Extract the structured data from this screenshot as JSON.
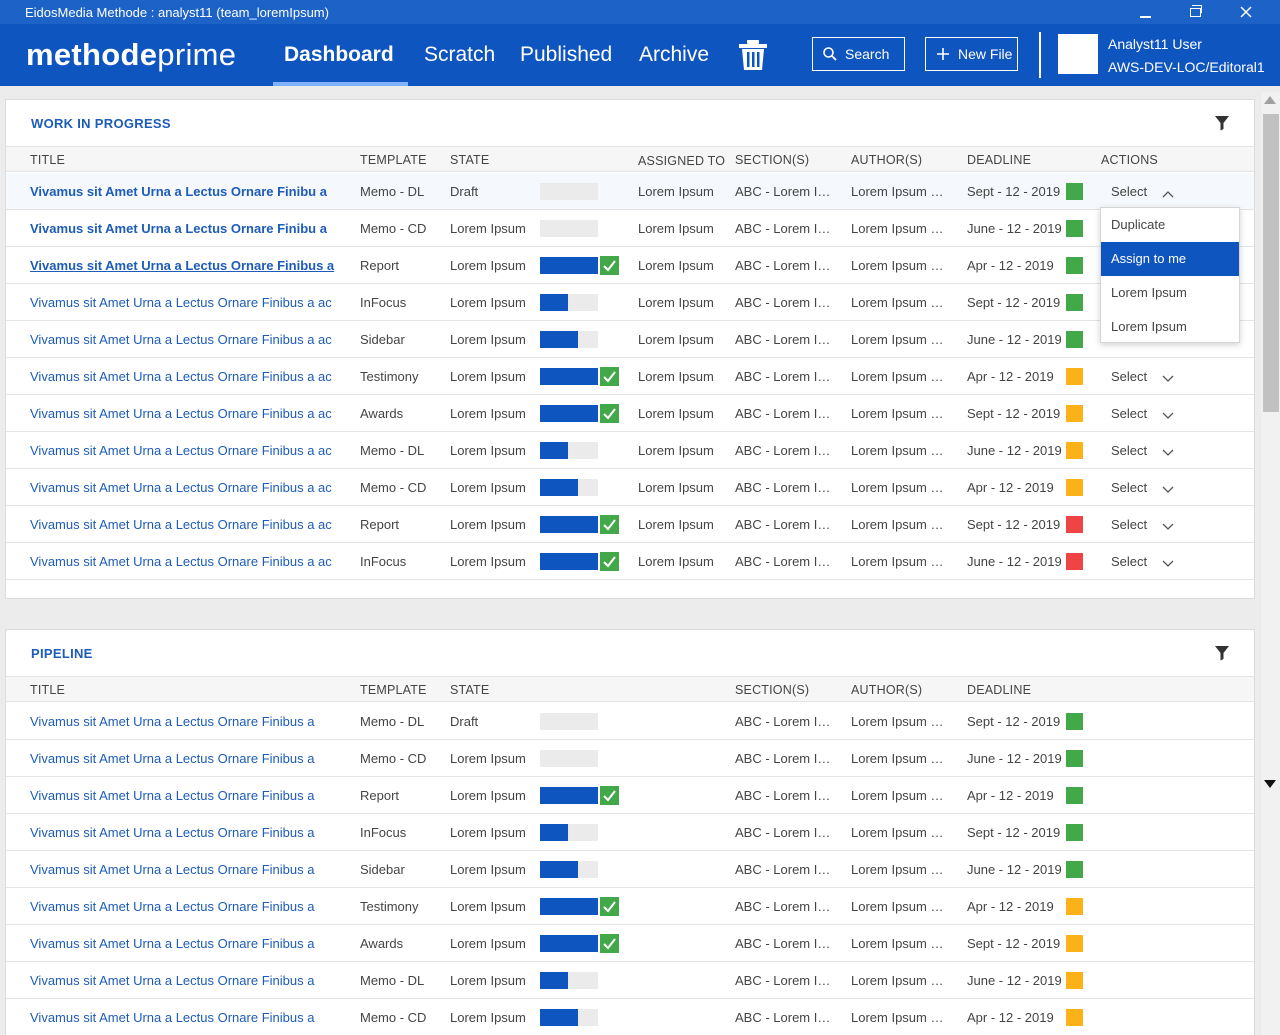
{
  "window": {
    "title": "EidosMedia Methode : analyst11 (team_loremIpsum)"
  },
  "brand": {
    "bold": "methode",
    "light": "prime"
  },
  "nav": [
    {
      "label": "Dashboard",
      "active": true
    },
    {
      "label": "Scratch"
    },
    {
      "label": "Published"
    },
    {
      "label": "Archive"
    }
  ],
  "header": {
    "search_label": "Search",
    "new_file_label": "New File",
    "user_name": "Analyst11 User",
    "user_org": "AWS-DEV-LOC/Editoral1"
  },
  "colors": {
    "accent": "#0f55c0",
    "green": "#43a84a",
    "orange": "#fbb117",
    "red": "#ef4444"
  },
  "wip": {
    "title": "WORK IN PROGRESS",
    "columns": {
      "title": "TITLE",
      "template": "TEMPLATE",
      "state": "STATE",
      "assigned": "ASSIGNED TO",
      "sections": "SECTION(S)",
      "authors": "AUTHOR(S)",
      "deadline": "DEADLINE",
      "actions": "ACTIONS"
    },
    "rows": [
      {
        "title": "Vivamus sit Amet Urna a Lectus Ornare Finibu a",
        "template": "Memo - DL",
        "state": "Draft",
        "progress": 0,
        "complete": false,
        "assigned": "Lorem Ipsum",
        "section": "ABC - Lorem Ipsum",
        "author": "Lorem Ipsum Dolor",
        "deadline": "Sept - 12 - 2019",
        "status": "green",
        "action": "Select",
        "style": "bold",
        "open": true
      },
      {
        "title": "Vivamus sit Amet Urna a Lectus Ornare Finibu a",
        "template": "Memo - CD",
        "state": "Lorem Ipsum",
        "progress": 0,
        "complete": false,
        "assigned": "Lorem Ipsum",
        "section": "ABC - Lorem Ipsum",
        "author": "Lorem Ipsum Dolor",
        "deadline": "June - 12 - 2019",
        "status": "green",
        "action": "",
        "style": "bold"
      },
      {
        "title": "Vivamus sit Amet Urna a Lectus Ornare Finibus a",
        "template": "Report",
        "state": "Lorem Ipsum",
        "progress": 1,
        "complete": true,
        "assigned": "Lorem Ipsum",
        "section": "ABC - Lorem Ipsum",
        "author": "Lorem Ipsum Dolor",
        "deadline": "Apr - 12 - 2019",
        "status": "green",
        "action": "",
        "style": "bold-under"
      },
      {
        "title": "Vivamus sit Amet Urna a Lectus Ornare Finibus a ac",
        "template": "InFocus",
        "state": "Lorem Ipsum",
        "progress": 0.48,
        "complete": false,
        "assigned": "Lorem Ipsum",
        "section": "ABC - Lorem Ipsum",
        "author": "Lorem Ipsum Dolor",
        "deadline": "Sept - 12 - 2019",
        "status": "green",
        "action": "",
        "style": "normal"
      },
      {
        "title": "Vivamus sit Amet Urna a Lectus Ornare Finibus a ac",
        "template": "Sidebar",
        "state": "Lorem Ipsum",
        "progress": 0.65,
        "complete": false,
        "assigned": "Lorem Ipsum",
        "section": "ABC - Lorem Ipsum",
        "author": "Lorem Ipsum Dolor",
        "deadline": "June - 12 - 2019",
        "status": "green",
        "action": "",
        "style": "normal"
      },
      {
        "title": "Vivamus sit Amet Urna a Lectus Ornare Finibus a ac",
        "template": "Testimony",
        "state": "Lorem Ipsum",
        "progress": 1,
        "complete": true,
        "assigned": "Lorem Ipsum",
        "section": "ABC - Lorem Ipsum",
        "author": "Lorem Ipsum Dolor",
        "deadline": "Apr - 12 - 2019",
        "status": "orange",
        "action": "Select",
        "style": "normal"
      },
      {
        "title": "Vivamus sit Amet Urna a Lectus Ornare Finibus a ac",
        "template": "Awards",
        "state": "Lorem Ipsum",
        "progress": 1,
        "complete": true,
        "assigned": "Lorem Ipsum",
        "section": "ABC - Lorem Ipsum",
        "author": "Lorem Ipsum Dolor",
        "deadline": "Sept - 12 - 2019",
        "status": "orange",
        "action": "Select",
        "style": "normal"
      },
      {
        "title": "Vivamus sit Amet Urna a Lectus Ornare Finibus a ac",
        "template": "Memo - DL",
        "state": "Lorem Ipsum",
        "progress": 0.48,
        "complete": false,
        "assigned": "Lorem Ipsum",
        "section": "ABC - Lorem Ipsum",
        "author": "Lorem Ipsum Dolor",
        "deadline": "June - 12 - 2019",
        "status": "orange",
        "action": "Select",
        "style": "normal"
      },
      {
        "title": "Vivamus sit Amet Urna a Lectus Ornare Finibus a ac",
        "template": "Memo - CD",
        "state": "Lorem Ipsum",
        "progress": 0.65,
        "complete": false,
        "assigned": "Lorem Ipsum",
        "section": "ABC - Lorem Ipsum",
        "author": "Lorem Ipsum Dolor",
        "deadline": "Apr - 12 - 2019",
        "status": "orange",
        "action": "Select",
        "style": "normal"
      },
      {
        "title": "Vivamus sit Amet Urna a Lectus Ornare Finibus a ac",
        "template": "Report",
        "state": "Lorem Ipsum",
        "progress": 1,
        "complete": true,
        "assigned": "Lorem Ipsum",
        "section": "ABC - Lorem Ipsum",
        "author": "Lorem Ipsum Dolor",
        "deadline": "Sept - 12 - 2019",
        "status": "red",
        "action": "Select",
        "style": "normal"
      },
      {
        "title": "Vivamus sit Amet Urna a Lectus Ornare Finibus a ac",
        "template": "InFocus",
        "state": "Lorem Ipsum",
        "progress": 1,
        "complete": true,
        "assigned": "Lorem Ipsum",
        "section": "ABC - Lorem Ipsum",
        "author": "Lorem Ipsum Dolor",
        "deadline": "June - 12 - 2019",
        "status": "red",
        "action": "Select",
        "style": "normal"
      }
    ],
    "menu": [
      {
        "label": "Duplicate"
      },
      {
        "label": "Assign to me",
        "selected": true
      },
      {
        "label": "Lorem Ipsum"
      },
      {
        "label": "Lorem Ipsum"
      }
    ]
  },
  "pipeline": {
    "title": "PIPELINE",
    "columns": {
      "title": "TITLE",
      "template": "TEMPLATE",
      "state": "STATE",
      "sections": "SECTION(S)",
      "authors": "AUTHOR(S)",
      "deadline": "DEADLINE"
    },
    "rows": [
      {
        "title": "Vivamus sit Amet Urna a Lectus Ornare Finibus a",
        "template": "Memo - DL",
        "state": "Draft",
        "progress": 0,
        "complete": false,
        "section": "ABC - Lorem Ipsum",
        "author": "Lorem Ipsum Dolor",
        "deadline": "Sept - 12 - 2019",
        "status": "green"
      },
      {
        "title": "Vivamus sit Amet Urna a Lectus Ornare Finibus a",
        "template": "Memo - CD",
        "state": "Lorem Ipsum",
        "progress": 0,
        "complete": false,
        "section": "ABC - Lorem Ipsum",
        "author": "Lorem Ipsum Dolor",
        "deadline": "June - 12 - 2019",
        "status": "green"
      },
      {
        "title": "Vivamus sit Amet Urna a Lectus Ornare Finibus a",
        "template": "Report",
        "state": "Lorem Ipsum",
        "progress": 1,
        "complete": true,
        "section": "ABC - Lorem Ipsum",
        "author": "Lorem Ipsum Dolor",
        "deadline": "Apr - 12 - 2019",
        "status": "green"
      },
      {
        "title": "Vivamus sit Amet Urna a Lectus Ornare Finibus a",
        "template": "InFocus",
        "state": "Lorem Ipsum",
        "progress": 0.48,
        "complete": false,
        "section": "ABC - Lorem Ipsum",
        "author": "Lorem Ipsum Dolor",
        "deadline": "Sept - 12 - 2019",
        "status": "green"
      },
      {
        "title": "Vivamus sit Amet Urna a Lectus Ornare Finibus a",
        "template": "Sidebar",
        "state": "Lorem Ipsum",
        "progress": 0.65,
        "complete": false,
        "section": "ABC - Lorem Ipsum",
        "author": "Lorem Ipsum Dolor",
        "deadline": "June - 12 - 2019",
        "status": "green"
      },
      {
        "title": "Vivamus sit Amet Urna a Lectus Ornare Finibus a",
        "template": "Testimony",
        "state": "Lorem Ipsum",
        "progress": 1,
        "complete": true,
        "section": "ABC - Lorem Ipsum",
        "author": "Lorem Ipsum Dolor",
        "deadline": "Apr - 12 - 2019",
        "status": "orange"
      },
      {
        "title": "Vivamus sit Amet Urna a Lectus Ornare Finibus a",
        "template": "Awards",
        "state": "Lorem Ipsum",
        "progress": 1,
        "complete": true,
        "section": "ABC - Lorem Ipsum",
        "author": "Lorem Ipsum Dolor",
        "deadline": "Sept - 12 - 2019",
        "status": "orange"
      },
      {
        "title": "Vivamus sit Amet Urna a Lectus Ornare Finibus a",
        "template": "Memo - DL",
        "state": "Lorem Ipsum",
        "progress": 0.48,
        "complete": false,
        "section": "ABC - Lorem Ipsum",
        "author": "Lorem Ipsum Dolor",
        "deadline": "June - 12 - 2019",
        "status": "orange"
      },
      {
        "title": "Vivamus sit Amet Urna a Lectus Ornare Finibus a",
        "template": "Memo - CD",
        "state": "Lorem Ipsum",
        "progress": 0.65,
        "complete": false,
        "section": "ABC - Lorem Ipsum",
        "author": "Lorem Ipsum Dolor",
        "deadline": "Apr - 12 - 2019",
        "status": "orange"
      }
    ]
  }
}
